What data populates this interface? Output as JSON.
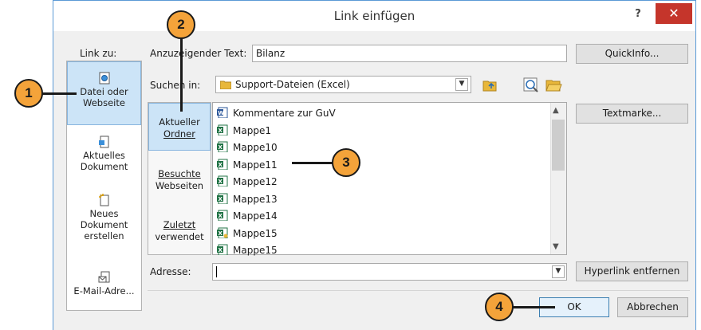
{
  "window": {
    "title": "Link einfügen",
    "help": "?",
    "close": "✕"
  },
  "left_panel": {
    "label": "Link zu:",
    "items": [
      {
        "label": "Datei oder Webseite",
        "icon": "web-page-icon",
        "selected": true
      },
      {
        "label": "Aktuelles Dokument",
        "icon": "document-icon",
        "selected": false
      },
      {
        "label": "Neues Dokument erstellen",
        "icon": "new-document-icon",
        "selected": false
      },
      {
        "label": "E-Mail-Adre...",
        "icon": "email-icon",
        "selected": false
      }
    ]
  },
  "display_text": {
    "label": "Anzuzeigender Text:",
    "value": "Bilanz",
    "quickinfo": "QuickInfo..."
  },
  "lookin": {
    "label": "Suchen in:",
    "value": "Support-Dateien (Excel)"
  },
  "inner_nav": [
    {
      "label1": "Aktueller",
      "label2": "Ordner",
      "selected": true
    },
    {
      "label1": "Besuchte",
      "label2": "Webseiten",
      "selected": false
    },
    {
      "label1": "Zuletzt",
      "label2": "verwendet",
      "selected": false
    }
  ],
  "files": [
    {
      "name": "Kommentare zur GuV",
      "type": "word"
    },
    {
      "name": "Mappe1",
      "type": "excel"
    },
    {
      "name": "Mappe10",
      "type": "excel"
    },
    {
      "name": "Mappe11",
      "type": "excel"
    },
    {
      "name": "Mappe12",
      "type": "excel"
    },
    {
      "name": "Mappe13",
      "type": "excel"
    },
    {
      "name": "Mappe14",
      "type": "excel"
    },
    {
      "name": "Mappe15",
      "type": "excel-macro"
    },
    {
      "name": "Mappe15",
      "type": "excel"
    }
  ],
  "bookmark_button": "Textmarke...",
  "address": {
    "label": "Adresse:",
    "value": ""
  },
  "remove_link_button": "Hyperlink entfernen",
  "ok_button": "OK",
  "cancel_button": "Abbrechen",
  "callouts": [
    "1",
    "2",
    "3",
    "4"
  ],
  "colors": {
    "accent": "#5a9ad6",
    "selection": "#cce4f7",
    "close": "#c5352b",
    "callout": "#f4a33a"
  }
}
